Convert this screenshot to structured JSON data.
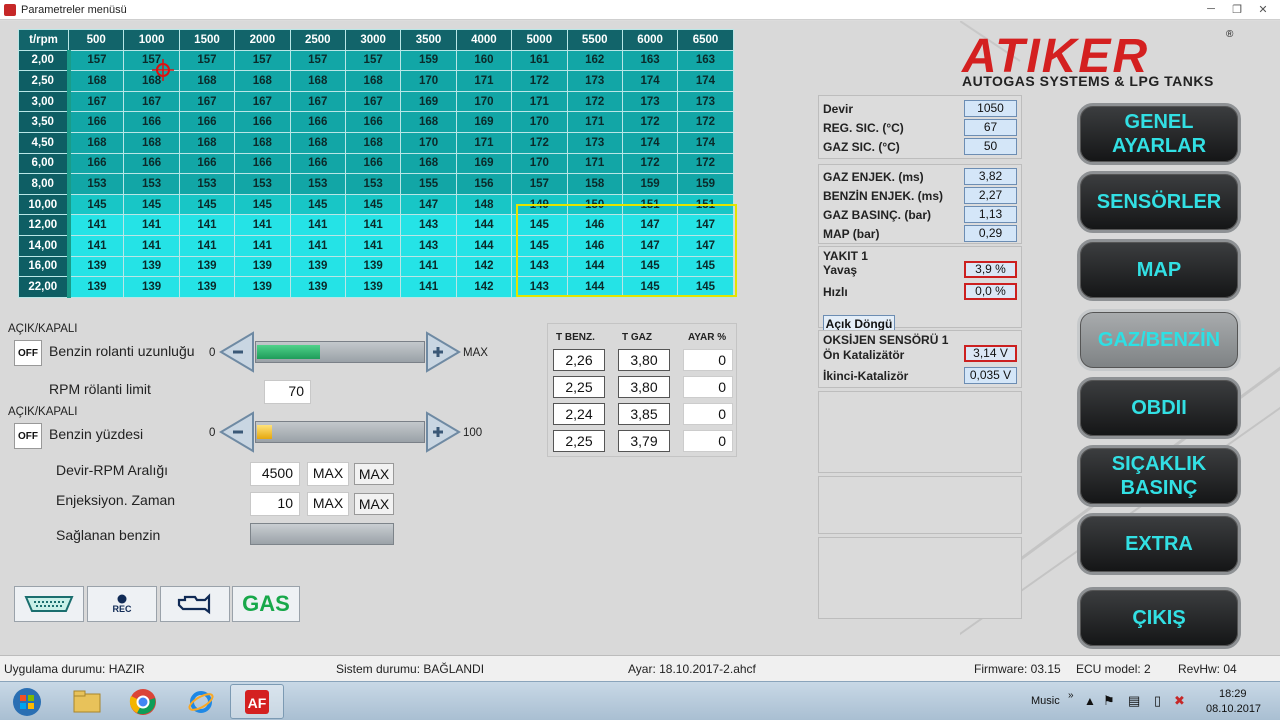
{
  "window": {
    "title": "Parametreler menüsü"
  },
  "map": {
    "corner": "t/rpm",
    "columns": [
      "500",
      "1000",
      "1500",
      "2000",
      "2500",
      "3000",
      "3500",
      "4000",
      "5000",
      "5500",
      "6000",
      "6500"
    ],
    "rows": [
      {
        "label": "2,00",
        "values": [
          "157",
          "157",
          "157",
          "157",
          "157",
          "157",
          "159",
          "160",
          "161",
          "162",
          "163",
          "163"
        ]
      },
      {
        "label": "2,50",
        "values": [
          "168",
          "168",
          "168",
          "168",
          "168",
          "168",
          "170",
          "171",
          "172",
          "173",
          "174",
          "174"
        ]
      },
      {
        "label": "3,00",
        "values": [
          "167",
          "167",
          "167",
          "167",
          "167",
          "167",
          "169",
          "170",
          "171",
          "172",
          "173",
          "173"
        ]
      },
      {
        "label": "3,50",
        "values": [
          "166",
          "166",
          "166",
          "166",
          "166",
          "166",
          "168",
          "169",
          "170",
          "171",
          "172",
          "172"
        ]
      },
      {
        "label": "4,50",
        "values": [
          "168",
          "168",
          "168",
          "168",
          "168",
          "168",
          "170",
          "171",
          "172",
          "173",
          "174",
          "174"
        ]
      },
      {
        "label": "6,00",
        "values": [
          "166",
          "166",
          "166",
          "166",
          "166",
          "166",
          "168",
          "169",
          "170",
          "171",
          "172",
          "172"
        ]
      },
      {
        "label": "8,00",
        "values": [
          "153",
          "153",
          "153",
          "153",
          "153",
          "153",
          "155",
          "156",
          "157",
          "158",
          "159",
          "159"
        ]
      },
      {
        "label": "10,00",
        "values": [
          "145",
          "145",
          "145",
          "145",
          "145",
          "145",
          "147",
          "148",
          "149",
          "150",
          "151",
          "151"
        ]
      },
      {
        "label": "12,00",
        "values": [
          "141",
          "141",
          "141",
          "141",
          "141",
          "141",
          "143",
          "144",
          "145",
          "146",
          "147",
          "147"
        ]
      },
      {
        "label": "14,00",
        "values": [
          "141",
          "141",
          "141",
          "141",
          "141",
          "141",
          "143",
          "144",
          "145",
          "146",
          "147",
          "147"
        ]
      },
      {
        "label": "16,00",
        "values": [
          "139",
          "139",
          "139",
          "139",
          "139",
          "139",
          "141",
          "142",
          "143",
          "144",
          "145",
          "145"
        ]
      },
      {
        "label": "22,00",
        "values": [
          "139",
          "139",
          "139",
          "139",
          "139",
          "139",
          "141",
          "142",
          "143",
          "144",
          "145",
          "145"
        ]
      }
    ]
  },
  "controls": {
    "onoff1_label": "AÇIK/KAPALI",
    "onoff1_state": "OFF",
    "rolanti_label": "Benzin rolanti uzunluğu",
    "slider1_min": "0",
    "slider1_max": "MAX",
    "slider1_level": 0.38,
    "rpm_limit_label": "RPM rölanti limit",
    "rpm_limit_value": "70",
    "onoff2_label": "AÇIK/KAPALI",
    "onoff2_state": "OFF",
    "benzin_yuzde_label": "Benzin yüzdesi",
    "slider2_min": "0",
    "slider2_max": "100",
    "slider2_level": 0.09,
    "devir_label": "Devir-RPM Aralığı",
    "devir_value": "4500",
    "devir_max_text": "MAX",
    "devir_max_btn": "MAX",
    "enj_label": "Enjeksiyon. Zaman",
    "enj_value": "10",
    "enj_max_text": "MAX",
    "enj_max_btn": "MAX",
    "saglanan_label": "Sağlanan benzin"
  },
  "tpanel": {
    "headers": [
      "T BENZ.",
      "T GAZ",
      "AYAR %"
    ],
    "rows": [
      [
        "2,26",
        "3,80",
        "0"
      ],
      [
        "2,25",
        "3,80",
        "0"
      ],
      [
        "2,24",
        "3,85",
        "0"
      ],
      [
        "2,25",
        "3,79",
        "0"
      ]
    ]
  },
  "info": {
    "devir_label": "Devir",
    "devir": "1050",
    "reg_label": "REG. SIC. (°C)",
    "reg": "67",
    "gaz_sic_label": "GAZ SIC. (°C)",
    "gaz_sic": "50",
    "gaz_enj_label": "GAZ ENJEK. (ms)",
    "gaz_enj": "3,82",
    "benzin_enj_label": "BENZİN ENJEK. (ms)",
    "benzin_enj": "2,27",
    "gaz_bas_label": "GAZ BASINÇ. (bar)",
    "gaz_bas": "1,13",
    "map_label": "MAP (bar)",
    "map": "0,29",
    "yakit_title": "YAKIT 1",
    "yavas_label": "Yavaş",
    "yavas": "3,9 %",
    "hizli_label": "Hızlı",
    "hizli": "0,0 %",
    "acik_dongu": "Açık Döngü",
    "oks_title": "OKSİJEN SENSÖRÜ 1",
    "on_kat_label": "Ön Katalizätör",
    "on_kat": "3,14 V",
    "ikinci_label": "İkinci-Katalizör",
    "ikinci": "0,035 V"
  },
  "logo": {
    "brand": "ATIKER",
    "sub": "AUTOGAS SYSTEMS & LPG TANKS",
    "reg": "®"
  },
  "menu": {
    "genel": "GENEL AYARLAR",
    "sensorler": "SENSÖRLER",
    "map": "MAP",
    "gaz_benzin": "GAZ/BENZİN",
    "obdii": "OBDII",
    "sicaklik": "SIÇAKLIK BASINÇ",
    "extra": "EXTRA",
    "cikis": "ÇIKIŞ"
  },
  "toolbar": {
    "rec": "REC",
    "gas": "GAS"
  },
  "status": {
    "app": "Uygulama durumu: HAZIR",
    "system": "Sistem durumu: BAĞLANDI",
    "ayar": "Ayar: 18.10.2017-2.ahcf",
    "firmware": "Firmware: 03.15",
    "ecu": "ECU model: 2",
    "revhw": "RevHw: 04"
  },
  "taskbar": {
    "music": "Music",
    "time": "18:29",
    "date": "08.10.2017"
  },
  "colors": {
    "accent": "#32e0e4",
    "brand": "#d42020",
    "highlight": "#e4e400"
  }
}
